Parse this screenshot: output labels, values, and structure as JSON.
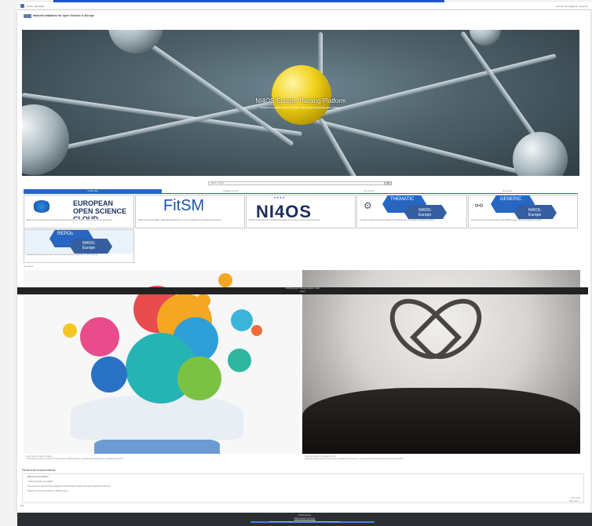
{
  "navbar": {
    "home_label": "Home | Spotlight",
    "login_label": "You are not logged in. (Log in)"
  },
  "site": {
    "title": "National Initiatives for Open Science in Europe"
  },
  "hero": {
    "title": "NI4OS-Europe Training Platform",
    "subtitle": "Access to a wide variety of content and courses covering open science"
  },
  "search": {
    "placeholder": "Search courses",
    "button": "Go"
  },
  "tabs": [
    {
      "label": "Course Tab"
    },
    {
      "label": "Available courses"
    },
    {
      "label": "My courses"
    },
    {
      "label": "All courses"
    }
  ],
  "cards": [
    {
      "title": "EUROPEAN OPEN SCIENCE CLOUD",
      "caption": "EOSC\nThis course presents the European Open Science Cloud - EOSC, which is a service for researchers."
    },
    {
      "title": "FitSM",
      "caption": "FitSM\nCourse about FitSM - lightweight standards for IT service management in federated environments."
    },
    {
      "title": "NI4OS",
      "caption": "NI4OS\nIntroduction to the NI4OS-Europe project and its open science services and tools."
    },
    {
      "title": "THEMATIC",
      "sub": "NI4OS-Europe",
      "caption": "Thematic\nThematic services provided by the NI4OS-Europe community for research domains."
    },
    {
      "title": "GENERIC",
      "sub": "NI4OS-Europe",
      "caption": "Generic\nGeneric services provided by the NI4OS-Europe project to its target user groups."
    },
    {
      "title": "REPOs",
      "sub": "NI4OS-Europe",
      "caption": "Repositories\nRepository services and open access practices supported by NI4OS-Europe."
    }
  ],
  "more_label": "All courses",
  "banner": {
    "line1": "NI4OS-Europe Training Platform | 2021",
    "line2": "Close"
  },
  "featured": [
    {
      "caption": "Open Science Training Content\nA collection of training modules for open science, FAIR principles, research data management, repositories and more."
    },
    {
      "caption": "Learning Resources | Reading Corner\nReading material and learning resources related to open science, open access and the European Open Science Cloud."
    }
  ],
  "recent": {
    "title": "Recent Announcements",
    "items": [
      "Welcome to the platform",
      "Training materials now available",
      "New courses on research data management and FAIR data principles have been published for all users",
      "Register for upcoming webinars on EOSC services"
    ],
    "date": "14 Apr 2021",
    "more": "Older topics..."
  },
  "left_label": "Skip",
  "footer": {
    "line1": "NI4OS-Europe",
    "line2": "Data retention summary",
    "line3": "This project has received funding from the European Union's Horizon 2020 research and innovation programme"
  },
  "colors": {
    "accent": "#2766c2",
    "top_banner": "#1f56c5",
    "footer": "#2b2f33"
  }
}
